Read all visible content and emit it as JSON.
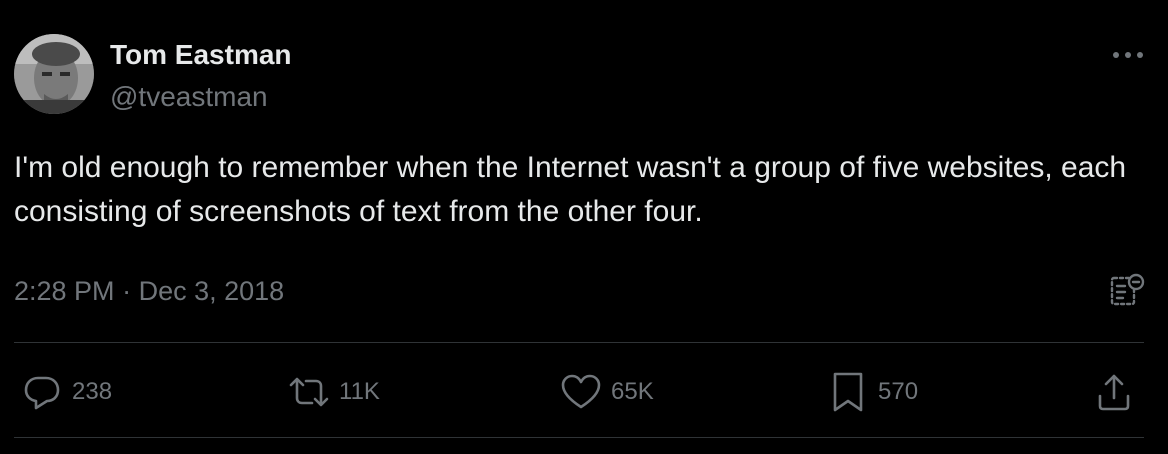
{
  "author": {
    "name": "Tom Eastman",
    "handle": "@tveastman",
    "avatar_icon": "profile-photo"
  },
  "tweet": {
    "text": "I'm old enough to remember when the Internet wasn't a group of five websites, each consisting of screenshots of text from the other four.",
    "time": "2:28 PM",
    "separator": "·",
    "date": "Dec 3, 2018"
  },
  "actions": {
    "reply": {
      "icon": "reply-icon",
      "count": "238"
    },
    "repost": {
      "icon": "repost-icon",
      "count": "11K"
    },
    "like": {
      "icon": "heart-icon",
      "count": "65K"
    },
    "bookmark": {
      "icon": "bookmark-icon",
      "count": "570"
    },
    "share": {
      "icon": "share-icon"
    }
  },
  "colors": {
    "background": "#000000",
    "primary_text": "#e7e9ea",
    "secondary_text": "#71767b",
    "divider": "#2f3336"
  }
}
